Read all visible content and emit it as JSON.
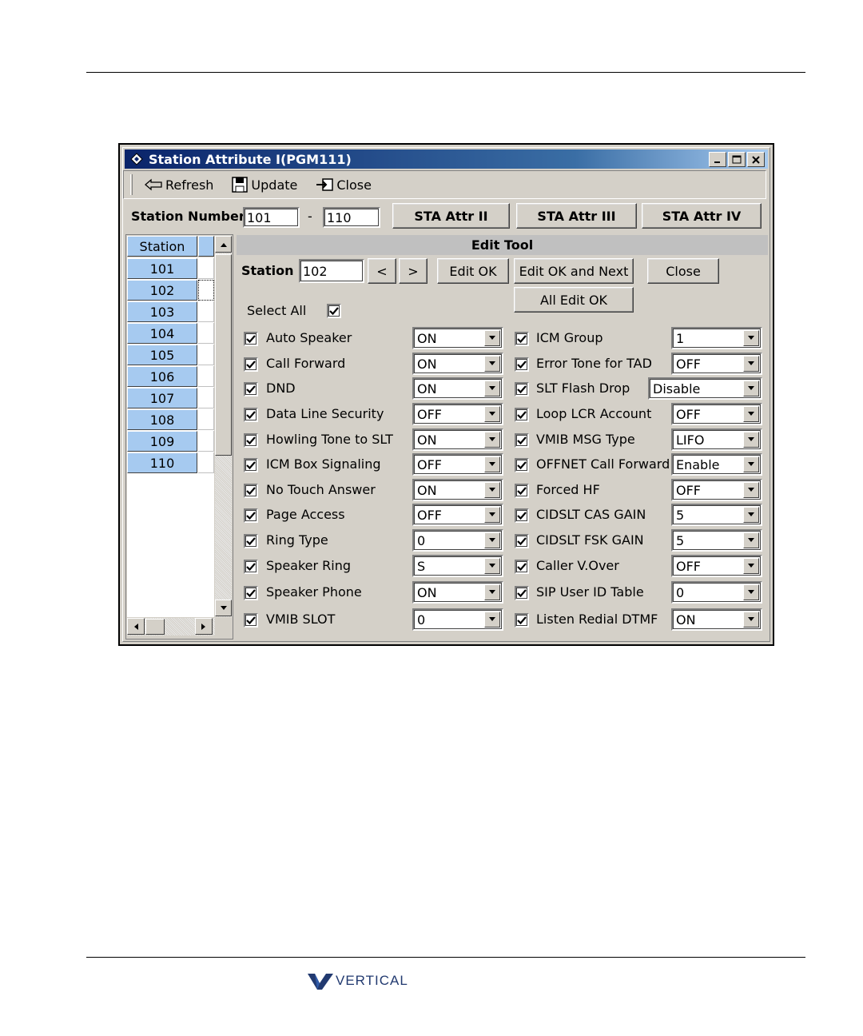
{
  "window": {
    "title": "Station Attribute I(PGM111)"
  },
  "toolbar": {
    "refresh": "Refresh",
    "update": "Update",
    "close": "Close"
  },
  "header": {
    "station_number_label": "Station Number",
    "range_from": "101",
    "range_sep": "-",
    "range_to": "110",
    "buttons": [
      "STA Attr II",
      "STA Attr III",
      "STA Attr IV"
    ]
  },
  "station_list": {
    "column": "Station",
    "rows": [
      "101",
      "102",
      "103",
      "104",
      "105",
      "106",
      "107",
      "108",
      "109",
      "110"
    ],
    "selected": "102"
  },
  "edit_tool": {
    "title": "Edit Tool",
    "station_label": "Station",
    "station_value": "102",
    "prev": "<",
    "next": ">",
    "edit_ok": "Edit OK",
    "edit_ok_next": "Edit OK and Next",
    "close": "Close",
    "all_edit_ok": "All Edit OK",
    "select_all": "Select All"
  },
  "left_attrs": [
    {
      "label": "Auto Speaker",
      "value": "ON",
      "checked": true
    },
    {
      "label": "Call Forward",
      "value": "ON",
      "checked": true
    },
    {
      "label": "DND",
      "value": "ON",
      "checked": true
    },
    {
      "label": "Data Line Security",
      "value": "OFF",
      "checked": true
    },
    {
      "label": "Howling Tone to SLT",
      "value": "ON",
      "checked": true
    },
    {
      "label": "ICM Box Signaling",
      "value": "OFF",
      "checked": true
    },
    {
      "label": "No Touch Answer",
      "value": "ON",
      "checked": true
    },
    {
      "label": "Page Access",
      "value": "OFF",
      "checked": true
    },
    {
      "label": "Ring Type",
      "value": "0",
      "checked": true
    },
    {
      "label": "Speaker Ring",
      "value": "S",
      "checked": true
    },
    {
      "label": "Speaker Phone",
      "value": "ON",
      "checked": true
    },
    {
      "label": "VMIB SLOT",
      "value": "0",
      "checked": true
    }
  ],
  "right_attrs": [
    {
      "label": "ICM Group",
      "value": "1",
      "checked": true
    },
    {
      "label": "Error Tone for TAD",
      "value": "OFF",
      "checked": true
    },
    {
      "label": "SLT Flash Drop",
      "value": "Disable",
      "checked": true
    },
    {
      "label": "Loop LCR Account",
      "value": "OFF",
      "checked": true
    },
    {
      "label": "VMIB MSG Type",
      "value": "LIFO",
      "checked": true
    },
    {
      "label": "OFFNET Call Forward",
      "value": "Enable",
      "checked": true
    },
    {
      "label": "Forced HF",
      "value": "OFF",
      "checked": true
    },
    {
      "label": "CIDSLT CAS GAIN",
      "value": "5",
      "checked": true
    },
    {
      "label": "CIDSLT FSK GAIN",
      "value": "5",
      "checked": true
    },
    {
      "label": "Caller V.Over",
      "value": "OFF",
      "checked": true
    },
    {
      "label": "SIP User ID Table",
      "value": "0",
      "checked": true
    },
    {
      "label": "Listen Redial DTMF",
      "value": "ON",
      "checked": true
    }
  ],
  "footer": {
    "brand": "VERTICAL",
    "brand_color": "#223a70"
  }
}
